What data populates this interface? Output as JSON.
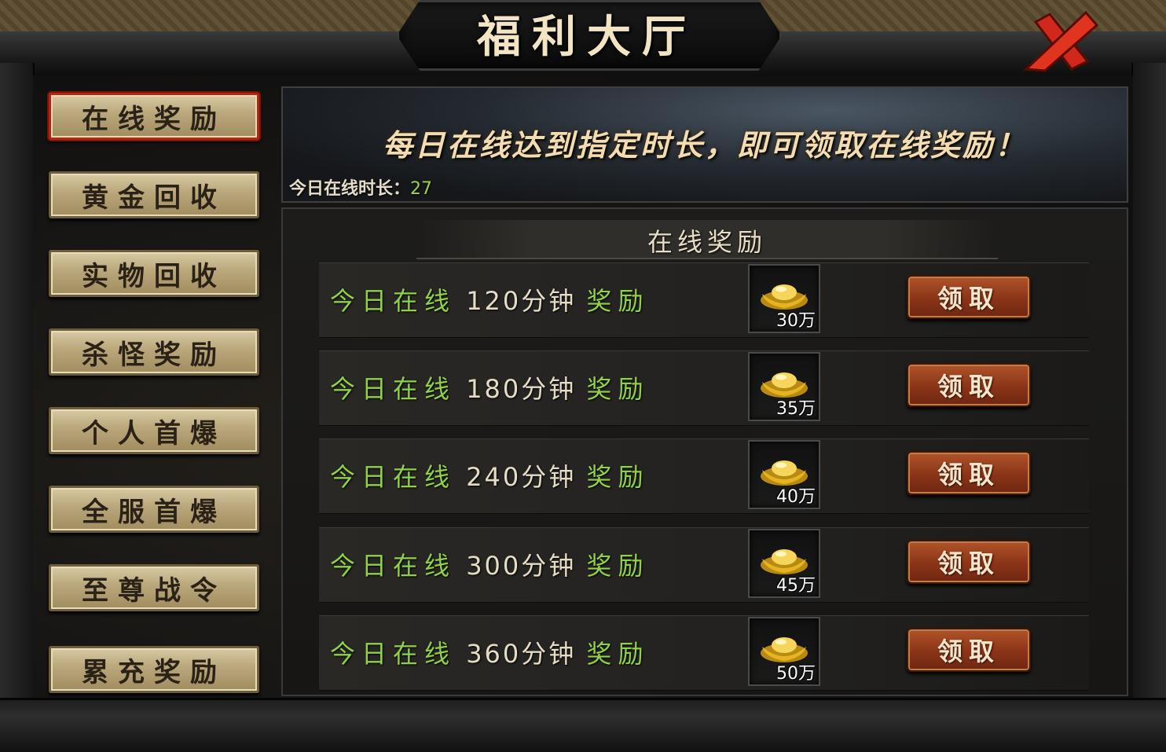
{
  "window": {
    "title": "福利大厅"
  },
  "menu": [
    {
      "label": "在线奖励",
      "active": true
    },
    {
      "label": "黄金回收"
    },
    {
      "label": "实物回收"
    },
    {
      "label": "杀怪奖励"
    },
    {
      "label": "个人首爆"
    },
    {
      "label": "全服首爆"
    },
    {
      "label": "至尊战令"
    },
    {
      "label": "累充奖励"
    }
  ],
  "banner": {
    "headline": "每日在线达到指定时长，即可领取在线奖励！",
    "online_label": "今日在线时长：",
    "online_value": "27"
  },
  "panel": {
    "title": "在线奖励"
  },
  "rewards": [
    {
      "prefix": "今日在线",
      "minutes": "120分钟",
      "suffix": "奖励",
      "item_icon": "gold-ingot-icon",
      "count": "30万",
      "button": "领取"
    },
    {
      "prefix": "今日在线",
      "minutes": "180分钟",
      "suffix": "奖励",
      "item_icon": "gold-ingot-icon",
      "count": "35万",
      "button": "领取"
    },
    {
      "prefix": "今日在线",
      "minutes": "240分钟",
      "suffix": "奖励",
      "item_icon": "gold-ingot-icon",
      "count": "40万",
      "button": "领取"
    },
    {
      "prefix": "今日在线",
      "minutes": "300分钟",
      "suffix": "奖励",
      "item_icon": "gold-ingot-icon",
      "count": "45万",
      "button": "领取"
    },
    {
      "prefix": "今日在线",
      "minutes": "360分钟",
      "suffix": "奖励",
      "item_icon": "gold-ingot-icon",
      "count": "50万",
      "button": "领取"
    }
  ],
  "colors": {
    "accent_green": "#8fd24a",
    "button_red": "#8a3418",
    "menu_gold": "#b9a67a",
    "active_border": "#b12714"
  }
}
